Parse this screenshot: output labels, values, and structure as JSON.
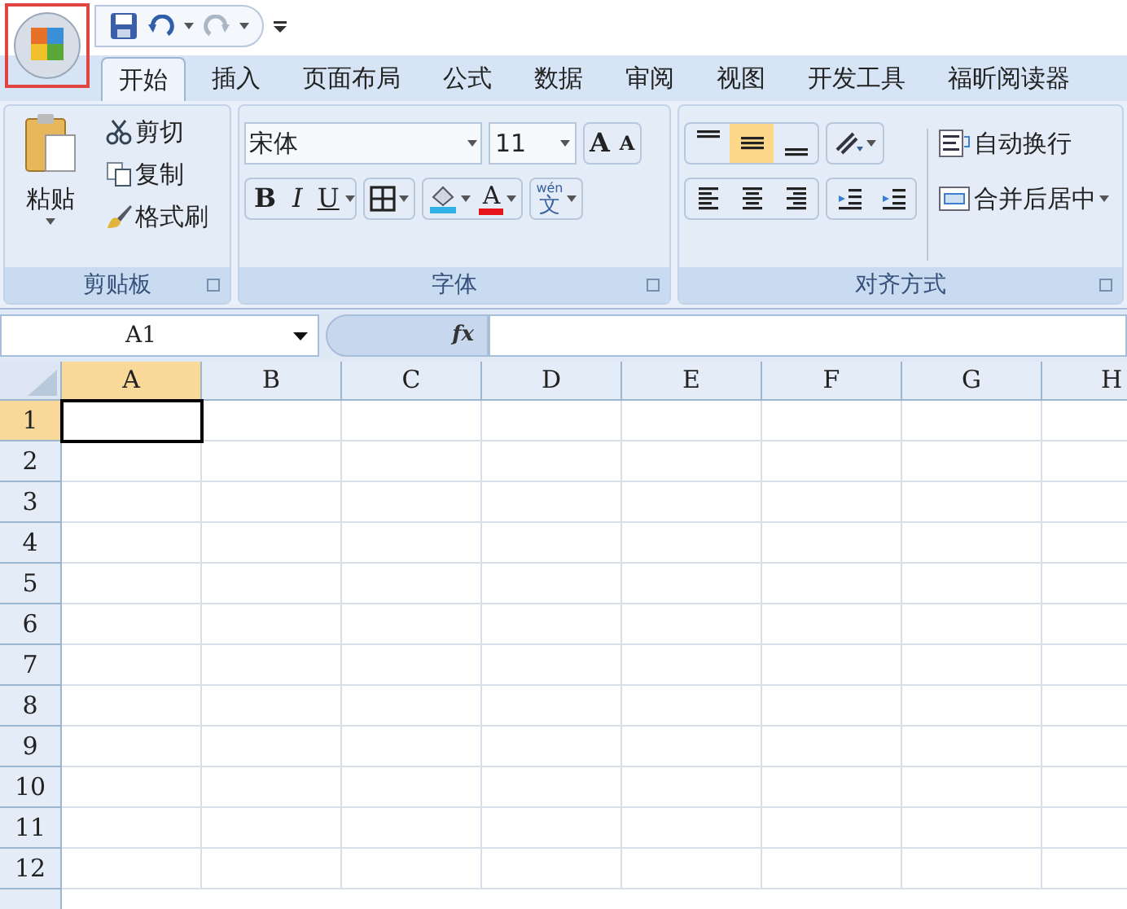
{
  "quick_access": {
    "redo": {
      "disabled": true
    }
  },
  "tabs": [
    {
      "label": "开始",
      "selected": true
    },
    {
      "label": "插入",
      "selected": false
    },
    {
      "label": "页面布局",
      "selected": false
    },
    {
      "label": "公式",
      "selected": false
    },
    {
      "label": "数据",
      "selected": false
    },
    {
      "label": "审阅",
      "selected": false
    },
    {
      "label": "视图",
      "selected": false
    },
    {
      "label": "开发工具",
      "selected": false
    },
    {
      "label": "福昕阅读器",
      "selected": false
    }
  ],
  "clipboard": {
    "paste": "粘贴",
    "cut": "剪切",
    "copy": "复制",
    "format_painter": "格式刷",
    "label": "剪贴板"
  },
  "font": {
    "name": "宋体",
    "size": "11",
    "grow": "A",
    "shrink": "A",
    "bold": "B",
    "italic": "I",
    "underline": "U",
    "font_color": "A",
    "phonetic_top": "wén",
    "phonetic_main": "文",
    "label": "字体"
  },
  "alignment": {
    "label": "对齐方式",
    "vertical": [
      {
        "kind": "top",
        "selected": false
      },
      {
        "kind": "middle",
        "selected": true
      },
      {
        "kind": "bottom",
        "selected": false
      }
    ],
    "wrap_text": "自动换行",
    "merge_center": "合并后居中"
  },
  "formula_bar": {
    "name_box": "A1",
    "fx": "fx"
  },
  "sheet": {
    "columns": [
      {
        "label": "A",
        "selected": true
      },
      {
        "label": "B",
        "selected": false
      },
      {
        "label": "C",
        "selected": false
      },
      {
        "label": "D",
        "selected": false
      },
      {
        "label": "E",
        "selected": false
      },
      {
        "label": "F",
        "selected": false
      },
      {
        "label": "G",
        "selected": false
      },
      {
        "label": "H",
        "selected": false
      }
    ],
    "rows": [
      {
        "label": "1",
        "selected": true
      },
      {
        "label": "2",
        "selected": false
      },
      {
        "label": "3",
        "selected": false
      },
      {
        "label": "4",
        "selected": false
      },
      {
        "label": "5",
        "selected": false
      },
      {
        "label": "6",
        "selected": false
      },
      {
        "label": "7",
        "selected": false
      },
      {
        "label": "8",
        "selected": false
      },
      {
        "label": "9",
        "selected": false
      },
      {
        "label": "10",
        "selected": false
      },
      {
        "label": "11",
        "selected": false
      },
      {
        "label": "12",
        "selected": false
      }
    ]
  }
}
